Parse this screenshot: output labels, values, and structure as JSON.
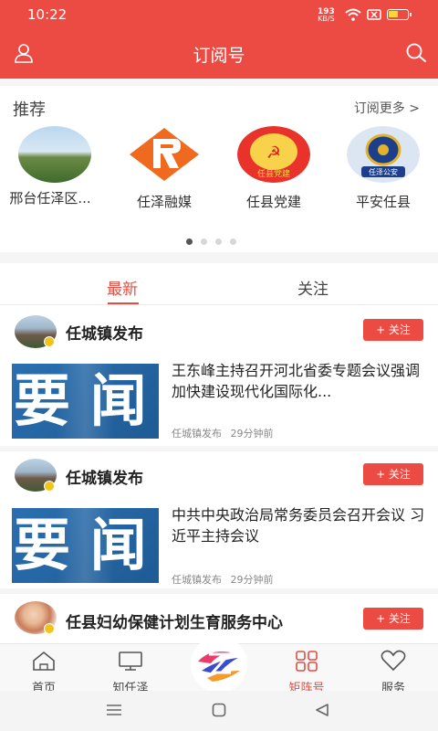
{
  "status": {
    "time": "10:22",
    "net_speed": "193",
    "net_unit": "KB/S"
  },
  "appbar": {
    "title": "订阅号"
  },
  "recommend": {
    "heading": "推荐",
    "more": "订阅更多 >",
    "items": [
      {
        "name": "邢台任泽区..."
      },
      {
        "name": "任泽融媒"
      },
      {
        "name": "任县党建",
        "logo_text": "任县党建"
      },
      {
        "name": "平安任县",
        "logo_text": "任泽公安"
      }
    ]
  },
  "tabs": [
    {
      "label": "最新"
    },
    {
      "label": "关注"
    }
  ],
  "feed": [
    {
      "publisher": "任城镇发布",
      "follow": "+ 关注",
      "thumb_text": "要 闻",
      "headline": "王东峰主持召开河北省委专题会议强调 加快建设现代化国际化...",
      "source": "任城镇发布",
      "time": "29分钟前"
    },
    {
      "publisher": "任城镇发布",
      "follow": "+ 关注",
      "thumb_text": "要 闻",
      "headline": "中共中央政治局常务委员会召开会议 习近平主持会议",
      "source": "任城镇发布",
      "time": "29分钟前"
    },
    {
      "publisher": "任县妇幼保健计划生育服务中心",
      "follow": "+ 关注"
    }
  ],
  "bottom_nav": [
    {
      "label": "首页",
      "icon": "home-icon"
    },
    {
      "label": "知任泽",
      "icon": "monitor-icon"
    },
    {
      "label": "",
      "icon": "center-logo"
    },
    {
      "label": "矩阵号",
      "icon": "grid-icon"
    },
    {
      "label": "服务",
      "icon": "heart-icon"
    }
  ],
  "colors": {
    "brand": "#ec4b44",
    "active": "#e54d42",
    "badge": "#f0c419"
  }
}
